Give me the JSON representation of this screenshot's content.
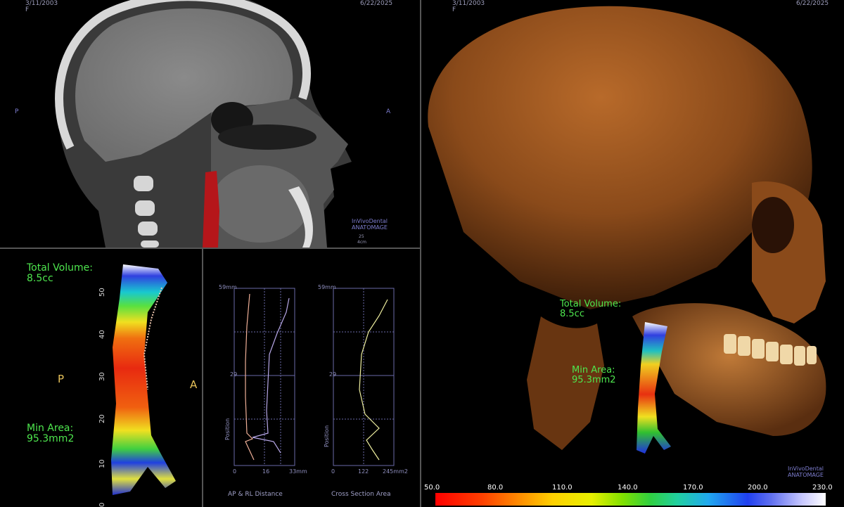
{
  "sagittal": {
    "date_left": "3/11/2003",
    "date_right": "6/22/2025",
    "sex": "F",
    "orient_left": "P",
    "orient_right": "A",
    "brand_line1": "InVivoDental",
    "brand_line2": "ANATOMAGE",
    "scale_value": "25",
    "scale_unit": "4cm"
  },
  "airway": {
    "total_volume_label": "Total Volume:",
    "total_volume_value": "8.5cc",
    "min_area_label": "Min Area:",
    "min_area_value": "95.3mm2",
    "orient_left": "P",
    "orient_right": "A",
    "ruler_ticks": [
      "50",
      "40",
      "30",
      "20",
      "10",
      "0"
    ]
  },
  "graphs": {
    "left": {
      "top_label": "59mm",
      "mid_label": "29",
      "y_label": "Position",
      "x_ticks": [
        "0",
        "16",
        "33mm"
      ],
      "caption": "AP & RL Distance"
    },
    "right": {
      "top_label": "59mm",
      "mid_label": "29",
      "y_label": "Position",
      "x_ticks": [
        "0",
        "122",
        "245mm2"
      ],
      "caption": "Cross Section Area"
    }
  },
  "render3d": {
    "date_left": "3/11/2003",
    "date_right": "6/22/2025",
    "sex": "F",
    "total_volume_label": "Total Volume:",
    "total_volume_value": "8.5cc",
    "min_area_label": "Min Area:",
    "min_area_value": "95.3mm2",
    "brand_line1": "InVivoDental",
    "brand_line2": "ANATOMAGE"
  },
  "color_scale": {
    "ticks": [
      "50.0",
      "80.0",
      "110.0",
      "140.0",
      "170.0",
      "200.0",
      "230.0"
    ]
  }
}
